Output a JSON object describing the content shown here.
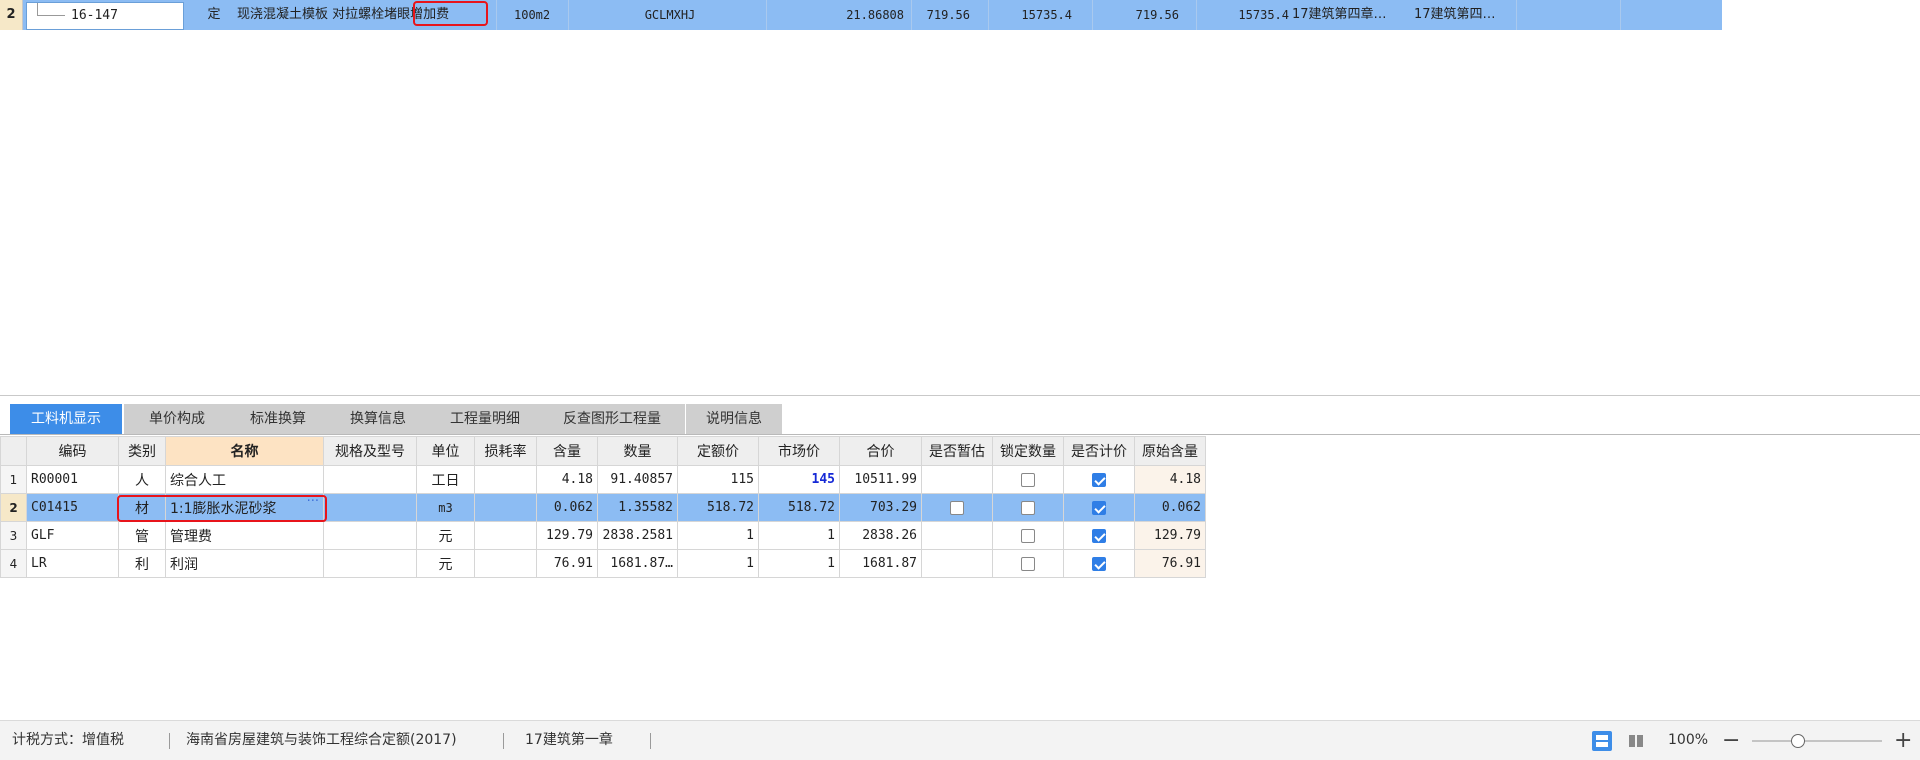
{
  "top_row": {
    "row_number": "2",
    "code": "16-147",
    "type": "定",
    "name": "现浇混凝土模板 对拉螺栓堵眼增加费",
    "unit": "100m2",
    "formula": "GCLMXHJ",
    "quantity": "21.86808",
    "unit_price": "719.56",
    "total": "15735.4",
    "unit_price_2": "719.56",
    "total_2": "15735.4",
    "chapter": "17建筑第四章…",
    "chapter_2": "17建筑第四…"
  },
  "tabs": [
    "工料机显示",
    "单价构成",
    "标准换算",
    "换算信息",
    "工程量明细",
    "反查图形工程量",
    "说明信息"
  ],
  "active_tab": 0,
  "grid": {
    "headers": [
      "",
      "编码",
      "类别",
      "名称",
      "规格及型号",
      "单位",
      "损耗率",
      "含量",
      "数量",
      "定额价",
      "市场价",
      "合价",
      "是否暂估",
      "锁定数量",
      "是否计价",
      "原始含量"
    ],
    "rows": [
      {
        "num": "1",
        "code": "R00001",
        "type": "人",
        "name": "综合人工",
        "spec": "",
        "unit": "工日",
        "loss": "",
        "content": "4.18",
        "qty": "91.40857",
        "quota": "115",
        "market": "145",
        "total": "10511.99",
        "estimate": null,
        "lock": false,
        "price": true,
        "orig": "4.18",
        "market_blue": true
      },
      {
        "num": "2",
        "code": "C01415",
        "type": "材",
        "name": "1:1膨胀水泥砂浆",
        "spec": "",
        "unit": "m3",
        "loss": "",
        "content": "0.062",
        "qty": "1.35582",
        "quota": "518.72",
        "market": "518.72",
        "total": "703.29",
        "estimate": false,
        "lock": false,
        "price": true,
        "orig": "0.062",
        "selected": true
      },
      {
        "num": "3",
        "code": "GLF",
        "type": "管",
        "name": "管理费",
        "spec": "",
        "unit": "元",
        "loss": "",
        "content": "129.79",
        "qty": "2838.2581",
        "quota": "1",
        "market": "1",
        "total": "2838.26",
        "estimate": null,
        "lock": false,
        "price": true,
        "orig": "129.79"
      },
      {
        "num": "4",
        "code": "LR",
        "type": "利",
        "name": "利润",
        "spec": "",
        "unit": "元",
        "loss": "",
        "content": "76.91",
        "qty": "1681.87…",
        "quota": "1",
        "market": "1",
        "total": "1681.87",
        "estimate": null,
        "lock": false,
        "price": true,
        "orig": "76.91"
      }
    ]
  },
  "status": {
    "tax": "计税方式：增值税",
    "quota_lib": "海南省房屋建筑与装饰工程综合定额(2017)",
    "chapter": "17建筑第一章",
    "zoom": "100%",
    "zoom_out": "−",
    "zoom_in": "+"
  },
  "colors": {
    "selected_row": "#8cbcf3",
    "active_tab": "#3d8de8",
    "highlight": "#e8141b",
    "checkbox_on": "#2f7ee6"
  }
}
